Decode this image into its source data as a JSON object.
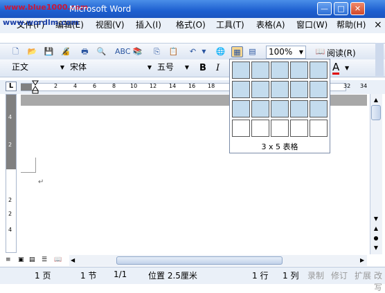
{
  "window": {
    "title": "Microsoft Word",
    "watermark_top": "www.blue1000.com",
    "watermark_menu": "www.wordlm.com"
  },
  "caption_buttons": {
    "minimize": "—",
    "maximize": "□",
    "close": "✕"
  },
  "menu": [
    "文件(F)",
    "编辑(E)",
    "视图(V)",
    "插入(I)",
    "格式(O)",
    "工具(T)",
    "表格(A)",
    "窗口(W)",
    "帮助(H)"
  ],
  "menu_close": "×",
  "toolbar": {
    "zoom": "100%",
    "read_label": "阅读(R)"
  },
  "format": {
    "style": "正文",
    "font": "宋体",
    "size": "五号",
    "bold": "B",
    "italic": "I",
    "font_color": "A"
  },
  "ruler": {
    "ticks": [
      "2",
      "4",
      "6",
      "8",
      "10",
      "12",
      "14",
      "16",
      "18",
      "32",
      "34"
    ],
    "corner": "L"
  },
  "vruler": {
    "ticks": [
      "4",
      "2",
      "2",
      "2",
      "4"
    ]
  },
  "table_picker": {
    "rows": 4,
    "cols": 5,
    "selected_rows": 3,
    "selected_cols": 5,
    "label": "3 x 5 表格"
  },
  "document": {
    "paragraph_mark": "↵"
  },
  "status": {
    "page": "1 页",
    "section": "1 节",
    "pages": "1/1",
    "position": "位置 2.5厘米",
    "line": "1 行",
    "col": "1 列",
    "rec": "录制",
    "trk": "修订",
    "ext": "扩展",
    "ovr": "改写"
  }
}
